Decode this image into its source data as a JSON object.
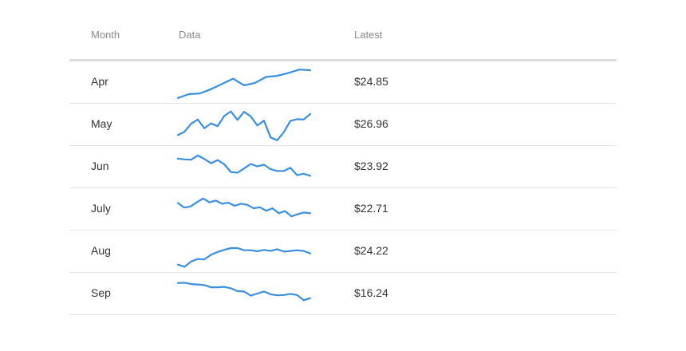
{
  "header": {
    "month": "Month",
    "data": "Data",
    "latest": "Latest"
  },
  "colors": {
    "sparkline": "#3b8fe0"
  },
  "chart_data": {
    "type": "table",
    "columns": [
      "Month",
      "Data",
      "Latest"
    ],
    "rows": [
      {
        "month": "Apr",
        "latest": "$24.85",
        "values": [
          5,
          16,
          18,
          30,
          45,
          60,
          41,
          48,
          65,
          68,
          76,
          86,
          84
        ]
      },
      {
        "month": "May",
        "latest": "$26.96",
        "values": [
          20,
          29,
          52,
          64,
          39,
          53,
          45,
          74,
          87,
          63,
          86,
          73,
          47,
          61,
          13,
          5,
          28,
          60,
          65,
          64,
          80
        ]
      },
      {
        "month": "Jun",
        "latest": "$23.92",
        "values": [
          73,
          71,
          70,
          82,
          72,
          60,
          69,
          57,
          35,
          33,
          45,
          58,
          51,
          56,
          43,
          38,
          38,
          47,
          26,
          30,
          24
        ]
      },
      {
        "month": "July",
        "latest": "$22.71",
        "values": [
          67,
          54,
          57,
          69,
          80,
          69,
          74,
          65,
          68,
          59,
          65,
          62,
          52,
          55,
          45,
          52,
          38,
          44,
          29,
          35,
          40,
          38
        ]
      },
      {
        "month": "Aug",
        "latest": "$24.22",
        "values": [
          12,
          6,
          21,
          28,
          27,
          40,
          48,
          54,
          59,
          59,
          53,
          53,
          50,
          54,
          51,
          56,
          49,
          51,
          53,
          51,
          44
        ]
      },
      {
        "month": "Sep",
        "latest": "$16.24",
        "values": [
          80,
          81,
          77,
          76,
          74,
          68,
          68,
          69,
          65,
          57,
          56,
          44,
          50,
          56,
          48,
          45,
          46,
          49,
          46,
          31,
          37
        ]
      }
    ]
  }
}
